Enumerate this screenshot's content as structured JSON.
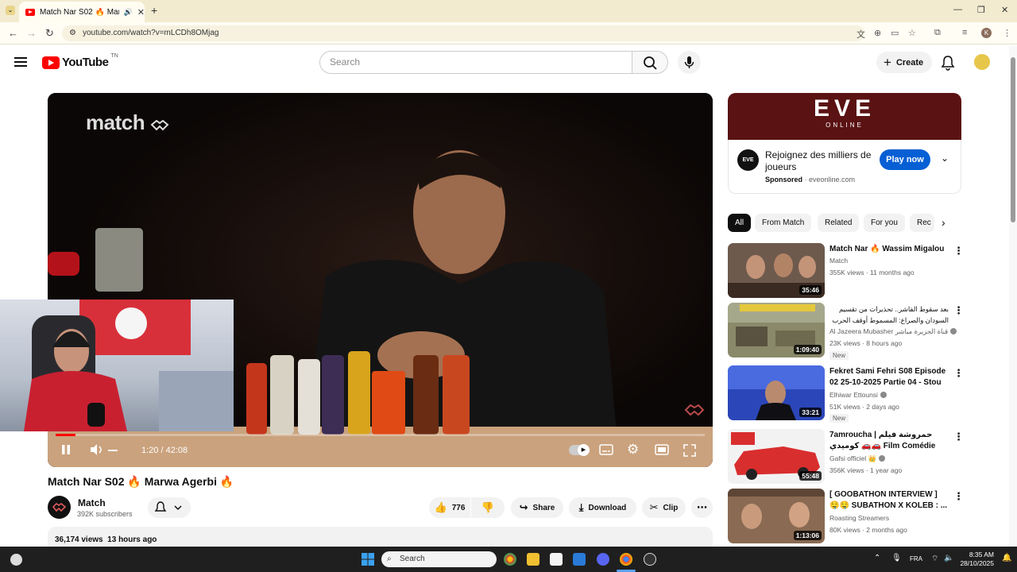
{
  "browser": {
    "tab_title": "Match Nar S02 🔥 Marwa A",
    "url": "youtube.com/watch?v=mLCDh8OMjag"
  },
  "header": {
    "logo_text": "YouTube",
    "logo_country": "TN",
    "search_placeholder": "Search",
    "create_label": "Create"
  },
  "player": {
    "time": "1:20 / 42:08",
    "progress_fraction": 0.031,
    "overlay_logo": "match"
  },
  "video": {
    "title": "Match Nar S02 🔥 Marwa Agerbi 🔥",
    "channel": "Match",
    "subscribers": "392K subscribers",
    "likes": "776",
    "share_label": "Share",
    "download_label": "Download",
    "clip_label": "Clip",
    "views": "36,174 views",
    "posted": "13 hours ago"
  },
  "ad": {
    "brand_line1": "EVE",
    "brand_line2": "ONLINE",
    "text": "Rejoignez des milliers de joueurs",
    "sponsored": "Sponsored",
    "domain": "eveonline.com",
    "cta": "Play now"
  },
  "chips": [
    "All",
    "From Match",
    "Related",
    "For you",
    "Rec"
  ],
  "recommendations": [
    {
      "title": "Match Nar 🔥 Wassim Migalou",
      "channel": "Match",
      "meta": "355K views · 11 months ago",
      "duration": "35:46",
      "new": "",
      "color": "#6d5a4d"
    },
    {
      "title": "بعد سقوط الفاشر.. تحذيرات من تقسيم السودان والصراع: المسموط أوقف الحرب",
      "channel": "Al Jazeera Mubasher قناة الجزيرة مباشر",
      "meta": "23K views · 8 hours ago",
      "duration": "1:09:40",
      "new": "New",
      "color": "#7d7a55"
    },
    {
      "title": "Fekret Sami Fehri S08 Episode 02 25-10-2025 Partie 04 - Stou",
      "channel": "Elhiwar Ettounsi",
      "meta": "51K views · 2 days ago",
      "duration": "33:21",
      "new": "New",
      "color": "#3c58c8"
    },
    {
      "title": "7amroucha | حمروشة فيلم كوميدي 🚗🚗 Film Comédie",
      "channel": "Gafsi officiel 👑",
      "meta": "356K views · 1 year ago",
      "duration": "55:48",
      "new": "",
      "color": "#d94a4a"
    },
    {
      "title": "[ GOOBATHON INTERVIEW ] 🤤🤤 SUBATHON X KOLEB : ...",
      "channel": "Roasting Streamers",
      "meta": "80K views · 2 months ago",
      "duration": "1:13:06",
      "new": "",
      "color": "#8a6a52"
    }
  ],
  "taskbar": {
    "search_placeholder": "Search",
    "lang": "FRA",
    "time": "8:35 AM",
    "date": "28/10/2025"
  }
}
